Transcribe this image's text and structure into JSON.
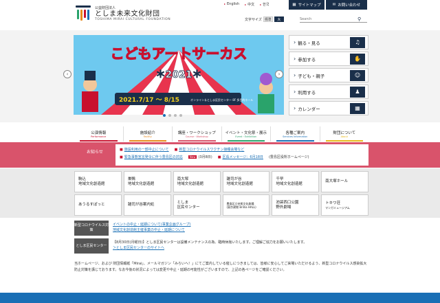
{
  "header": {
    "org_sub": "公益財団法人",
    "org_name": "としま未来文化財団",
    "org_en": "TOSHIMA MIRAI CULTURAL FOUNDATION",
    "langs": [
      "English",
      "中文",
      "한국"
    ],
    "sitemap_label": "サイトマップ",
    "contact_label": "お問い合わせ",
    "font_size_label": "文字サイズ",
    "font_std": "標準",
    "font_big": "大",
    "search_placeholder": "Search"
  },
  "hero": {
    "title": "こどもアートサーカス",
    "year": "＊2021＊",
    "dates": "2021.7/17 ～ 8/15",
    "sub": "オンライン＆としま区民センター 8F 多目的ホール"
  },
  "side_menu": [
    {
      "label": "観る・見る",
      "icon": "stage-icon"
    },
    {
      "label": "参加する",
      "icon": "hand-icon"
    },
    {
      "label": "子ども・親子",
      "icon": "family-icon"
    },
    {
      "label": "利用する",
      "icon": "people-icon"
    },
    {
      "label": "カレンダー",
      "icon": "calendar-icon"
    }
  ],
  "gnav": [
    {
      "ja": "公演情報",
      "en": "Performance",
      "color": "#c8102e"
    },
    {
      "ja": "施設紹介",
      "en": "Facility",
      "color": "#e8891a"
    },
    {
      "ja": "講座・ワークショップ",
      "en": "Course・Workshop",
      "color": "#d9536b"
    },
    {
      "ja": "イベント・文化祭・展示",
      "en": "Event・Exhibition",
      "color": "#2aa36b"
    },
    {
      "ja": "各種ご案内",
      "en": "Services Information",
      "color": "#1a6fb5"
    },
    {
      "ja": "財団について",
      "en": "About",
      "color": "#e8b81a"
    }
  ],
  "notice": {
    "label": "お知らせ",
    "row1": [
      "施設利用の一部中止について",
      "新型コロナウイルスワクチン接種会場など"
    ],
    "row2a": "緊急事態宣言発令に伴う豊島区の対応",
    "new": "New",
    "row2b": "(3月8日)",
    "row2c": "区長メッセージ：6月18日",
    "row2d": "(豊島区役所ホームページ)"
  },
  "centers": [
    {
      "name": "駒込",
      "sub": "地域文化創造館"
    },
    {
      "name": "巣鴨",
      "sub": "地域文化創造館"
    },
    {
      "name": "南大塚",
      "sub": "地域文化創造館"
    },
    {
      "name": "雑司が谷",
      "sub": "地域文化創造館"
    },
    {
      "name": "千早",
      "sub": "地域文化創造館"
    },
    {
      "name": "南大塚ホール",
      "sub": ""
    },
    {
      "name": "あうるすぽっと",
      "sub": ""
    },
    {
      "name": "雑司が谷案内処",
      "sub": ""
    },
    {
      "name": "としま",
      "sub": "区民センター"
    },
    {
      "name": "豊島区立芸術文化劇場",
      "sub": "(東京建物 Brillia HALL)"
    },
    {
      "name": "池袋西口公園",
      "sub": "野外劇場"
    },
    {
      "name": "トキワ荘",
      "sub": "マンガミュージアム"
    }
  ],
  "info": [
    {
      "tag": "新型コロナウイルス対策",
      "lines": [
        "イベントの中止・延期について(事業企画グループ)",
        "地域文化創造館主催事業の中止・延期について"
      ]
    },
    {
      "tag": "としま区民センター",
      "lines": [
        "【8月30日(月曜日)】としま区民センターは設備メンテナンスの為、臨時休館いたします。ご理解ご協力をお願いいたします。",
        "＞としま区民センターのサイトへ"
      ]
    }
  ],
  "footnote": "当ホームページ、および 財団情報紙「Mirai」、メールマガジン「みらいへ！」にてご案内している催しにつきましては、皆様に安心してご来場いただけるよう、新型コロナウイルス感染拡大防止対策を講じております。なお今後の状況によっては変更や中止・延期の可能性がございますので、上記の各ページをご確認ください。",
  "colors": {
    "navy": "#1a2f4a",
    "notice": "#d9536b",
    "link": "#1a6fb5"
  }
}
